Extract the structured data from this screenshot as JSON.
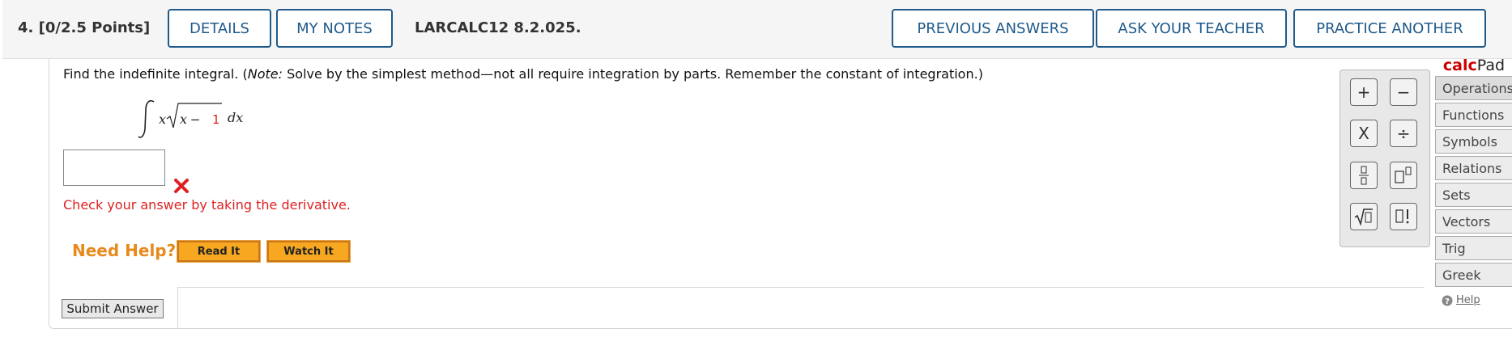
{
  "header": {
    "question_number": "4.",
    "points": "[0/2.5 Points]",
    "details_label": "DETAILS",
    "my_notes_label": "MY NOTES",
    "problem_code": "LARCALC12 8.2.025.",
    "previous_answers_label": "PREVIOUS ANSWERS",
    "ask_teacher_label": "ASK YOUR TEACHER",
    "practice_another_label": "PRACTICE ANOTHER"
  },
  "question": {
    "prompt_pre": "Find the indefinite integral. (",
    "prompt_note": "Note:",
    "prompt_post": " Solve by the simplest method—not all require integration by parts. Remember the constant of integration.)",
    "integral_integrand_var": "x",
    "integral_radicand_x": "x",
    "integral_minus": " − ",
    "integral_radicand_const": "1",
    "integral_dx": "dx",
    "answer_value": "",
    "feedback": "Check your answer by taking the derivative."
  },
  "help": {
    "need_help_label": "Need Help?",
    "read_it_label": "Read It",
    "watch_it_label": "Watch It"
  },
  "submit_label": "Submit Answer",
  "keypad": {
    "plus": "+",
    "minus": "−",
    "times": "X",
    "divide": "÷",
    "fraction": "fraction-icon",
    "power": "power-icon",
    "sqrt": "sqrt-icon",
    "factorial": "factorial-icon"
  },
  "calcpad": {
    "title_calc": "calc",
    "title_pad": "Pad",
    "tabs": [
      "Operations",
      "Functions",
      "Symbols",
      "Relations",
      "Sets",
      "Vectors",
      "Trig",
      "Greek"
    ],
    "help_label": "Help"
  },
  "colors": {
    "header_button_border": "#1f5a8b",
    "error_red": "#d22",
    "need_help_orange": "#e8891c",
    "help_button_fill": "#f7a820"
  }
}
